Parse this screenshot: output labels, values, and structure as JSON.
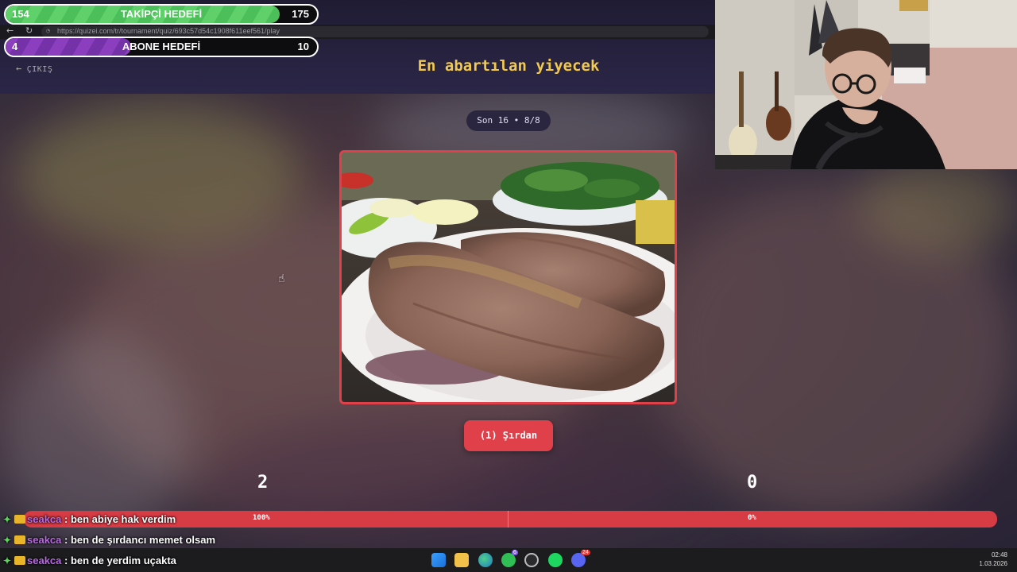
{
  "overlay": {
    "followers_goal": {
      "current": "154",
      "title": "TAKİPÇİ HEDEFİ",
      "target": "175",
      "progress": 0.88
    },
    "subscribers_goal": {
      "current": "4",
      "title": "ABONE HEDEFİ",
      "target": "10",
      "progress": 0.4
    }
  },
  "browser": {
    "url": "https://quizei.com/tr/tournament/quiz/693c57d54c1908f611eef561/play"
  },
  "header": {
    "exit_label": "ÇIKIŞ",
    "title": "En abartılan yiyecek"
  },
  "game": {
    "round_label": "Son 16 • 8/8",
    "image_subject": "şırdan dish",
    "choice_label": "(1) Şırdan",
    "score_left": "2",
    "score_right": "0",
    "vote_left_pct": "100%",
    "vote_right_pct": "0%"
  },
  "chat": [
    {
      "user": "seakca",
      "message": ": ben abiye hak verdim"
    },
    {
      "user": "seakca",
      "message": ": ben de şırdancı memet olsam"
    },
    {
      "user": "seakca",
      "message": ": ben de yerdim uçakta"
    }
  ],
  "taskbar": {
    "time": "02:48",
    "date": "1.03.2026",
    "icons": [
      "windows-start-icon",
      "file-explorer-icon",
      "edge-browser-icon",
      "whatsapp-icon",
      "chatgpt-icon",
      "spotify-icon",
      "discord-icon"
    ],
    "badges": {
      "whatsapp": "6",
      "discord": "24"
    }
  },
  "colors": {
    "accent_red": "#e0404a",
    "title_yellow": "#f2c94c",
    "follower_green": "#5fd06a",
    "subscriber_purple": "#8b3fbf",
    "chat_user": "#b86be0"
  }
}
